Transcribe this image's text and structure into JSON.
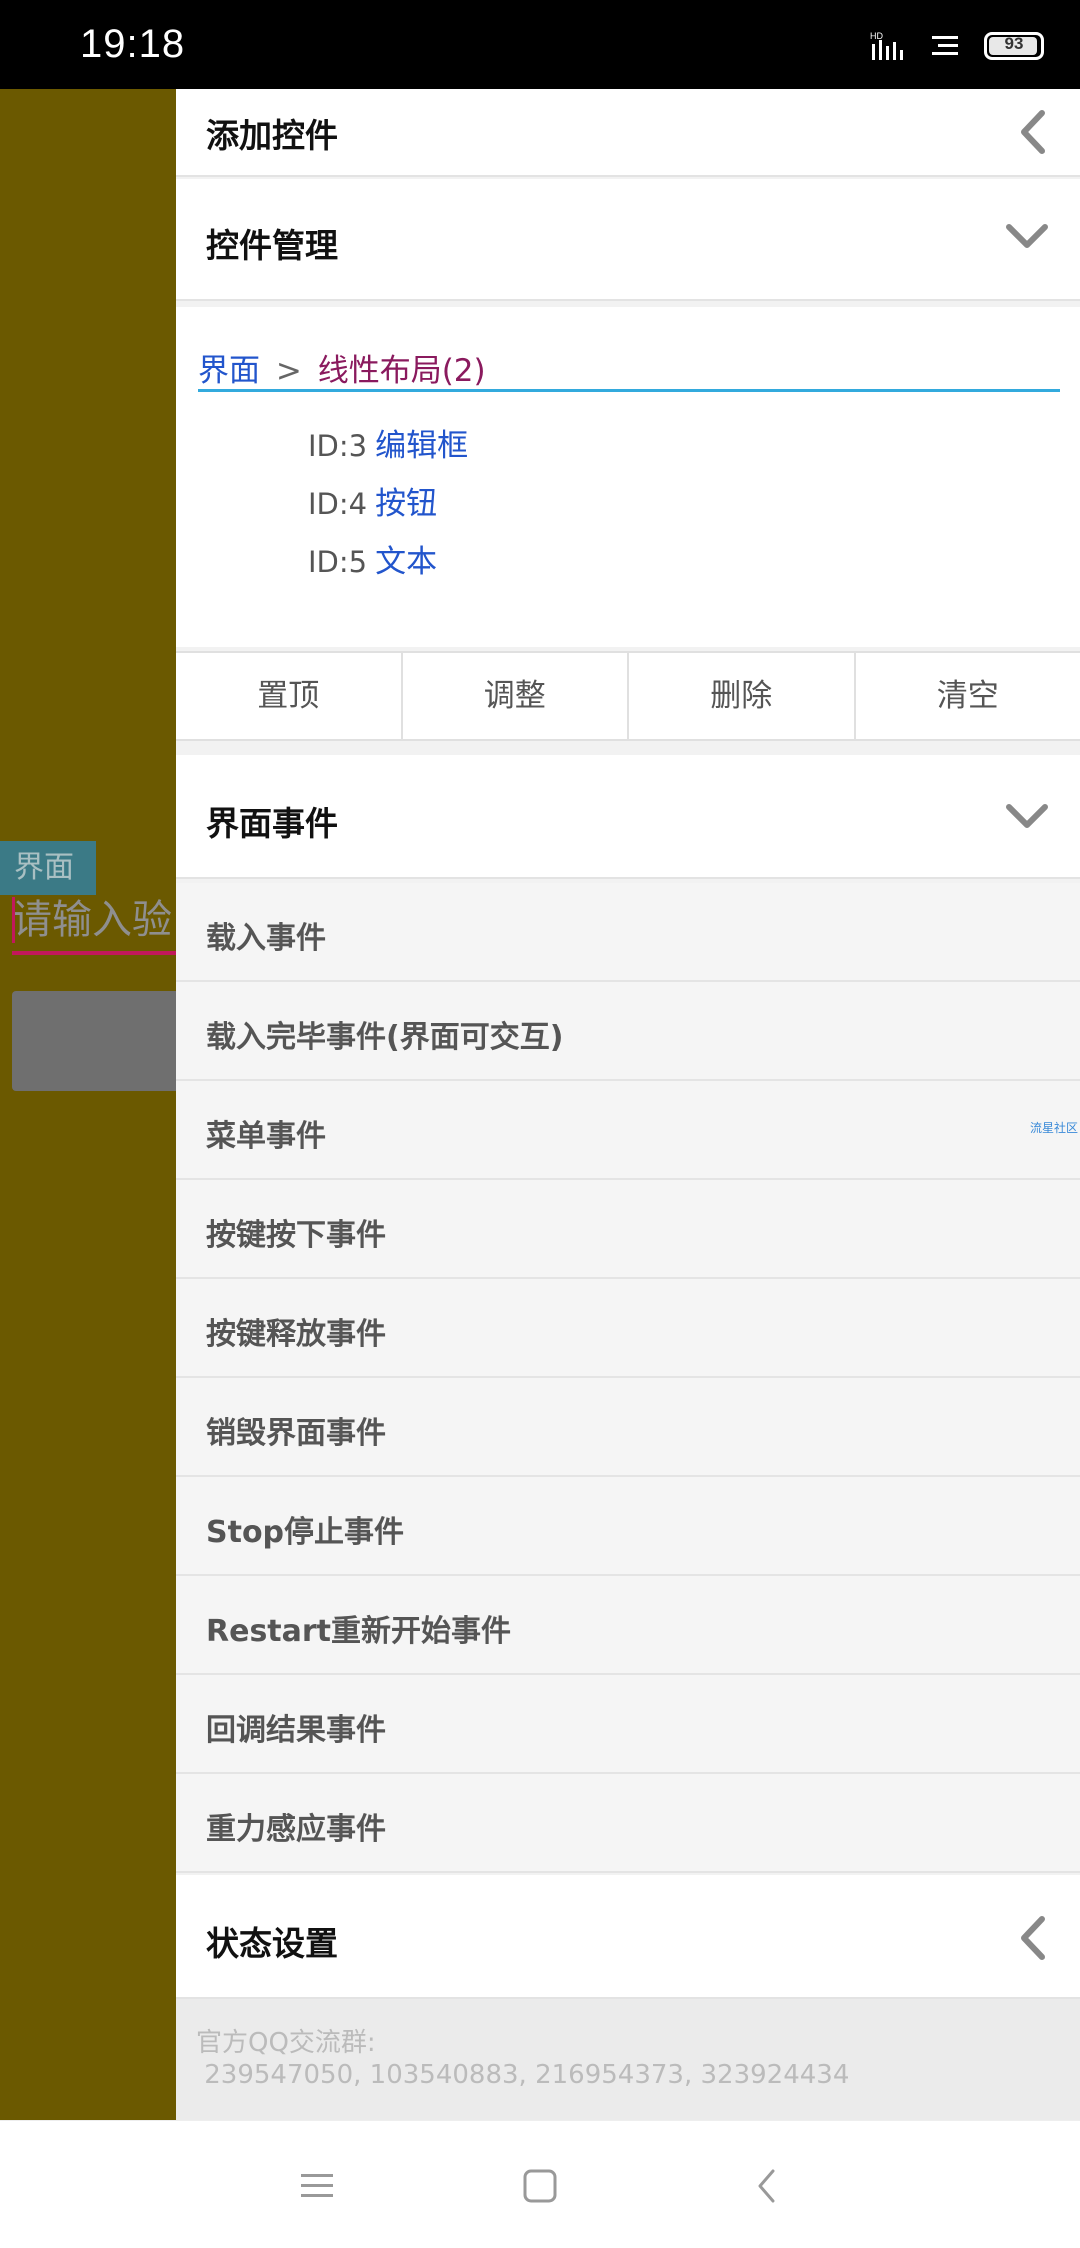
{
  "status_bar": {
    "time": "19:18",
    "battery_level": "93",
    "icons": [
      "hd-signal-icon",
      "notification-lines-icon",
      "battery-icon"
    ]
  },
  "background_app": {
    "label": "界面",
    "input_placeholder": "请输入验",
    "bg_color": "#6b5900"
  },
  "drawer": {
    "add_control": {
      "title": "添加控件",
      "icon": "chevron-left-icon"
    },
    "control_manage": {
      "title": "控件管理",
      "icon": "chevron-down-icon"
    },
    "breadcrumb": {
      "root": "界面",
      "separator": ">",
      "current": "线性布局(2)"
    },
    "controls": [
      {
        "id": "ID:3",
        "name": "编辑框"
      },
      {
        "id": "ID:4",
        "name": "按钮"
      },
      {
        "id": "ID:5",
        "name": "文本"
      }
    ],
    "actions": [
      "置顶",
      "调整",
      "删除",
      "清空"
    ],
    "ui_events": {
      "title": "界面事件",
      "icon": "chevron-down-icon"
    },
    "events": [
      "载入事件",
      "载入完毕事件(界面可交互)",
      "菜单事件",
      "按键按下事件",
      "按键释放事件",
      "销毁界面事件",
      "Stop停止事件",
      "Restart重新开始事件",
      "回调结果事件",
      "重力感应事件"
    ],
    "state_settings": {
      "title": "状态设置",
      "icon": "chevron-left-icon"
    },
    "watermark": "流星社区",
    "footer": {
      "line1": "官方QQ交流群:",
      "line2": " 239547050, 103540883, 216954373, 323924434"
    }
  },
  "nav_bar": {
    "icons": [
      "menu-icon",
      "home-icon",
      "back-icon"
    ]
  }
}
